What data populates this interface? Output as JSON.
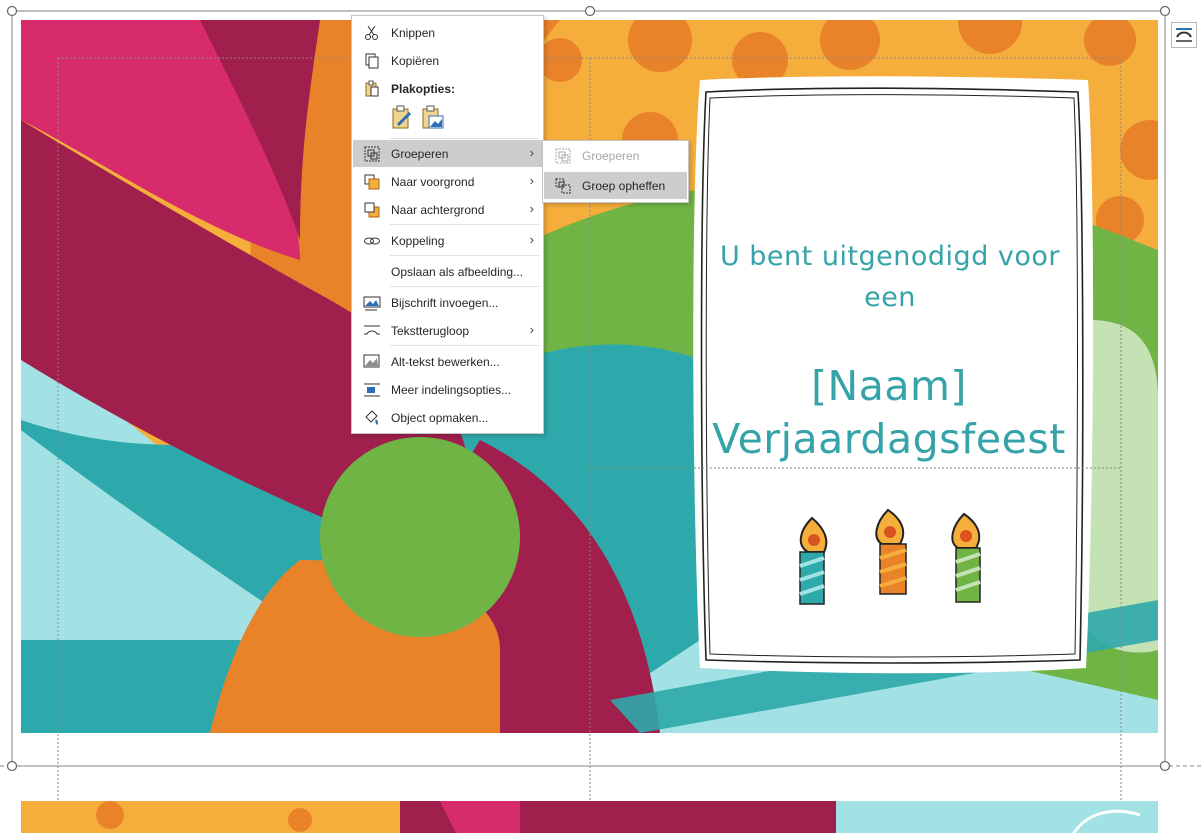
{
  "card": {
    "invite_text": "U bent uitgenodigd voor een",
    "name_line": "[Naam]",
    "party_line": "Verjaardagsfeest"
  },
  "context_menu": {
    "items": [
      {
        "label": "Knippen",
        "icon": "scissors-icon"
      },
      {
        "label": "Kopiëren",
        "icon": "copy-icon"
      },
      {
        "label": "Plakopties:",
        "icon": "paste-icon"
      },
      {
        "label": "Groeperen",
        "icon": "group-icon",
        "has_submenu": true,
        "highlighted": true
      },
      {
        "label": "Naar voorgrond",
        "icon": "bring-forward-icon",
        "has_submenu": true
      },
      {
        "label": "Naar achtergrond",
        "icon": "send-backward-icon",
        "has_submenu": true
      },
      {
        "label": "Koppeling",
        "icon": "link-icon",
        "has_submenu": true
      },
      {
        "label": "Opslaan als afbeelding...",
        "icon": ""
      },
      {
        "label": "Bijschrift invoegen...",
        "icon": "caption-icon"
      },
      {
        "label": "Tekstterugloop",
        "icon": "text-wrap-icon",
        "has_submenu": true
      },
      {
        "label": "Alt-tekst bewerken...",
        "icon": "alt-text-icon"
      },
      {
        "label": "Meer indelingsopties...",
        "icon": "layout-options-icon"
      },
      {
        "label": "Object opmaken...",
        "icon": "format-object-icon"
      }
    ]
  },
  "submenu": {
    "items": [
      {
        "label": "Groeperen",
        "disabled": true,
        "icon": "group-icon"
      },
      {
        "label": "Groep opheffen",
        "highlighted": true,
        "icon": "ungroup-icon"
      }
    ]
  },
  "colors": {
    "accent_text": "#35a3a8",
    "menu_highlight": "#cfcdcb"
  }
}
